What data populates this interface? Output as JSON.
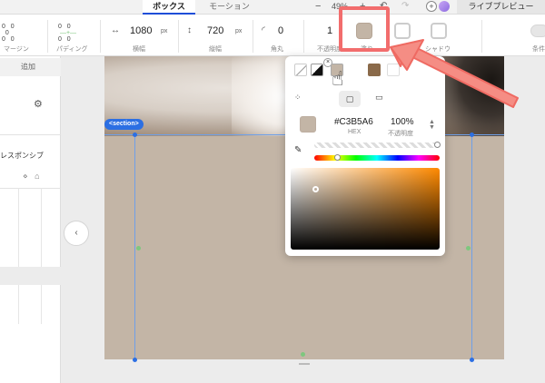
{
  "tabs": {
    "box": "ボックス",
    "motion": "モーション"
  },
  "zoom": {
    "minus": "−",
    "value": "49%",
    "plus": "+"
  },
  "history": {
    "undo": "↶",
    "redo": "↷"
  },
  "header": {
    "preview": "ライブプレビュー"
  },
  "toolbar": {
    "margin_label": "マージン",
    "padding_label": "パディング",
    "width_value": "1080",
    "width_unit": "px",
    "width_label": "横幅",
    "height_value": "720",
    "height_unit": "px",
    "height_label": "縦幅",
    "radius_value": "0",
    "radius_label": "角丸",
    "opacity_value": "1",
    "opacity_label": "不透明度",
    "fill_label": "塗り",
    "border_label": "枠線",
    "shadow_label": "シャドウ",
    "condition_label": "条件"
  },
  "left_panel": {
    "add": "追加",
    "responsive": "レスポンシブ"
  },
  "canvas": {
    "section_tag": "<section>"
  },
  "picker": {
    "hex": "#C3B5A6",
    "hex_label": "HEX",
    "opacity": "100%",
    "opacity_label": "不透明度",
    "fill_color": "#C3B5A6"
  },
  "colors": {
    "accent": "#2c6fe3",
    "highlight": "#f26d6d",
    "fill": "#C3B5A6"
  },
  "icons": [
    "margin-icon",
    "padding-icon",
    "width-icon",
    "height-icon",
    "radius-icon",
    "fill-swatch",
    "border-swatch",
    "shadow-swatch",
    "eyedropper-icon",
    "hand-cursor-icon",
    "chevron-left-icon",
    "settings-sliders-icon"
  ]
}
